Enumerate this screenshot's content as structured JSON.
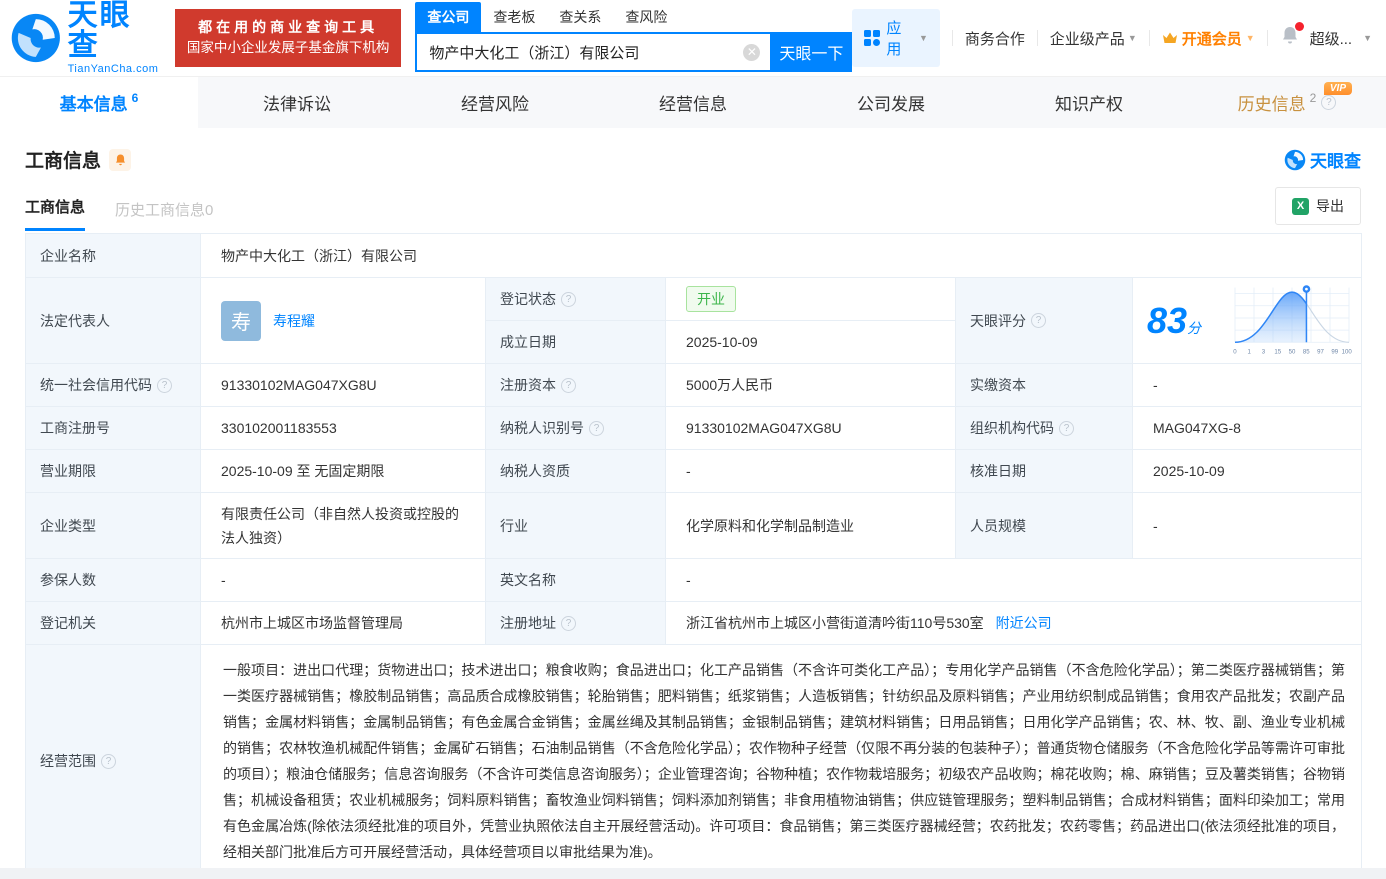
{
  "brand": {
    "logo_title": "天眼查",
    "logo_subtitle": "TianYanCha.com",
    "banner_line1": "都在用的商业查询工具",
    "banner_line2": "国家中小企业发展子基金旗下机构"
  },
  "header": {
    "search_tabs": [
      {
        "label": "查公司"
      },
      {
        "label": "查老板"
      },
      {
        "label": "查关系"
      },
      {
        "label": "查风险"
      }
    ],
    "search_value": "物产中大化工（浙江）有限公司",
    "search_button": "天眼一下",
    "nav": {
      "apps": "应用",
      "cooperation": "商务合作",
      "enterprise": "企业级产品",
      "vip": "开通会员",
      "super": "超级..."
    }
  },
  "tabs": [
    {
      "label": "基本信息",
      "count": "6"
    },
    {
      "label": "法律诉讼",
      "count": ""
    },
    {
      "label": "经营风险",
      "count": ""
    },
    {
      "label": "经营信息",
      "count": ""
    },
    {
      "label": "公司发展",
      "count": ""
    },
    {
      "label": "知识产权",
      "count": ""
    },
    {
      "label": "历史信息",
      "count": "2",
      "vip_badge": "VIP"
    }
  ],
  "section": {
    "title": "工商信息",
    "watermark": "天眼查"
  },
  "subtabs": {
    "current": "工商信息",
    "history": "历史工商信息0",
    "export": "导出"
  },
  "info": {
    "name_label": "企业名称",
    "name": "物产中大化工（浙江）有限公司",
    "legal_label": "法定代表人",
    "legal_avatar": "寿",
    "legal_name": "寿程耀",
    "reg_status_label": "登记状态",
    "reg_status": "开业",
    "establish_label": "成立日期",
    "establish_date": "2025-10-09",
    "score_label": "天眼评分",
    "score_value": "83",
    "score_unit": "分",
    "credit_code_label": "统一社会信用代码",
    "credit_code": "91330102MAG047XG8U",
    "reg_capital_label": "注册资本",
    "reg_capital": "5000万人民币",
    "paid_capital_label": "实缴资本",
    "paid_capital": "-",
    "reg_number_label": "工商注册号",
    "reg_number": "330102001183553",
    "taxpayer_id_label": "纳税人识别号",
    "taxpayer_id": "91330102MAG047XG8U",
    "org_code_label": "组织机构代码",
    "org_code": "MAG047XG-8",
    "business_term_label": "营业期限",
    "business_term": "2025-10-09 至 无固定期限",
    "taxpayer_quality_label": "纳税人资质",
    "taxpayer_quality": "-",
    "approval_date_label": "核准日期",
    "approval_date": "2025-10-09",
    "company_type_label": "企业类型",
    "company_type": "有限责任公司（非自然人投资或控股的法人独资）",
    "industry_label": "行业",
    "industry": "化学原料和化学制品制造业",
    "staff_size_label": "人员规模",
    "staff_size": "-",
    "insured_label": "参保人数",
    "insured": "-",
    "english_name_label": "英文名称",
    "english_name": "-",
    "reg_authority_label": "登记机关",
    "reg_authority": "杭州市上城区市场监督管理局",
    "address_label": "注册地址",
    "address": "浙江省杭州市上城区小营街道清吟街110号530室",
    "nearby_link": "附近公司",
    "scope_label": "经营范围",
    "scope": "一般项目：进出口代理；货物进出口；技术进出口；粮食收购；食品进出口；化工产品销售（不含许可类化工产品）；专用化学产品销售（不含危险化学品）；第二类医疗器械销售；第一类医疗器械销售；橡胶制品销售；高品质合成橡胶销售；轮胎销售；肥料销售；纸浆销售；人造板销售；针纺织品及原料销售；产业用纺织制成品销售；食用农产品批发；农副产品销售；金属材料销售；金属制品销售；有色金属合金销售；金属丝绳及其制品销售；金银制品销售；建筑材料销售；日用品销售；日用化学产品销售；农、林、牧、副、渔业专业机械的销售；农林牧渔机械配件销售；金属矿石销售；石油制品销售（不含危险化学品）；农作物种子经营（仅限不再分装的包装种子）；普通货物仓储服务（不含危险化学品等需许可审批的项目）；粮油仓储服务；信息咨询服务（不含许可类信息咨询服务）；企业管理咨询；谷物种植；农作物栽培服务；初级农产品收购；棉花收购；棉、麻销售；豆及薯类销售；谷物销售；机械设备租赁；农业机械服务；饲料原料销售；畜牧渔业饲料销售；饲料添加剂销售；非食用植物油销售；供应链管理服务；塑料制品销售；合成材料销售；面料印染加工；常用有色金属冶炼(除依法须经批准的项目外，凭营业执照依法自主开展经营活动)。许可项目：食品销售；第三类医疗器械经营；农药批发；农药零售；药品进出口(依法须经批准的项目，经相关部门批准后方可开展经营活动，具体经营项目以审批结果为准)。"
  },
  "chart_data": {
    "type": "area",
    "title": "天眼评分分布曲线",
    "x_ticks": [
      "0",
      "1",
      "3",
      "15",
      "50",
      "85",
      "97",
      "99",
      "100"
    ],
    "marker_value": "83",
    "marker_tick": "85",
    "peak_tick": "50",
    "accent_color": "#3d8ef7",
    "grid": true
  },
  "colors": {
    "primary_blue": "#0084ff",
    "banner_red": "#d03a2d",
    "vip_orange": "#ff8000",
    "status_green": "#3bb54a",
    "label_bg": "#f2f7fc"
  }
}
